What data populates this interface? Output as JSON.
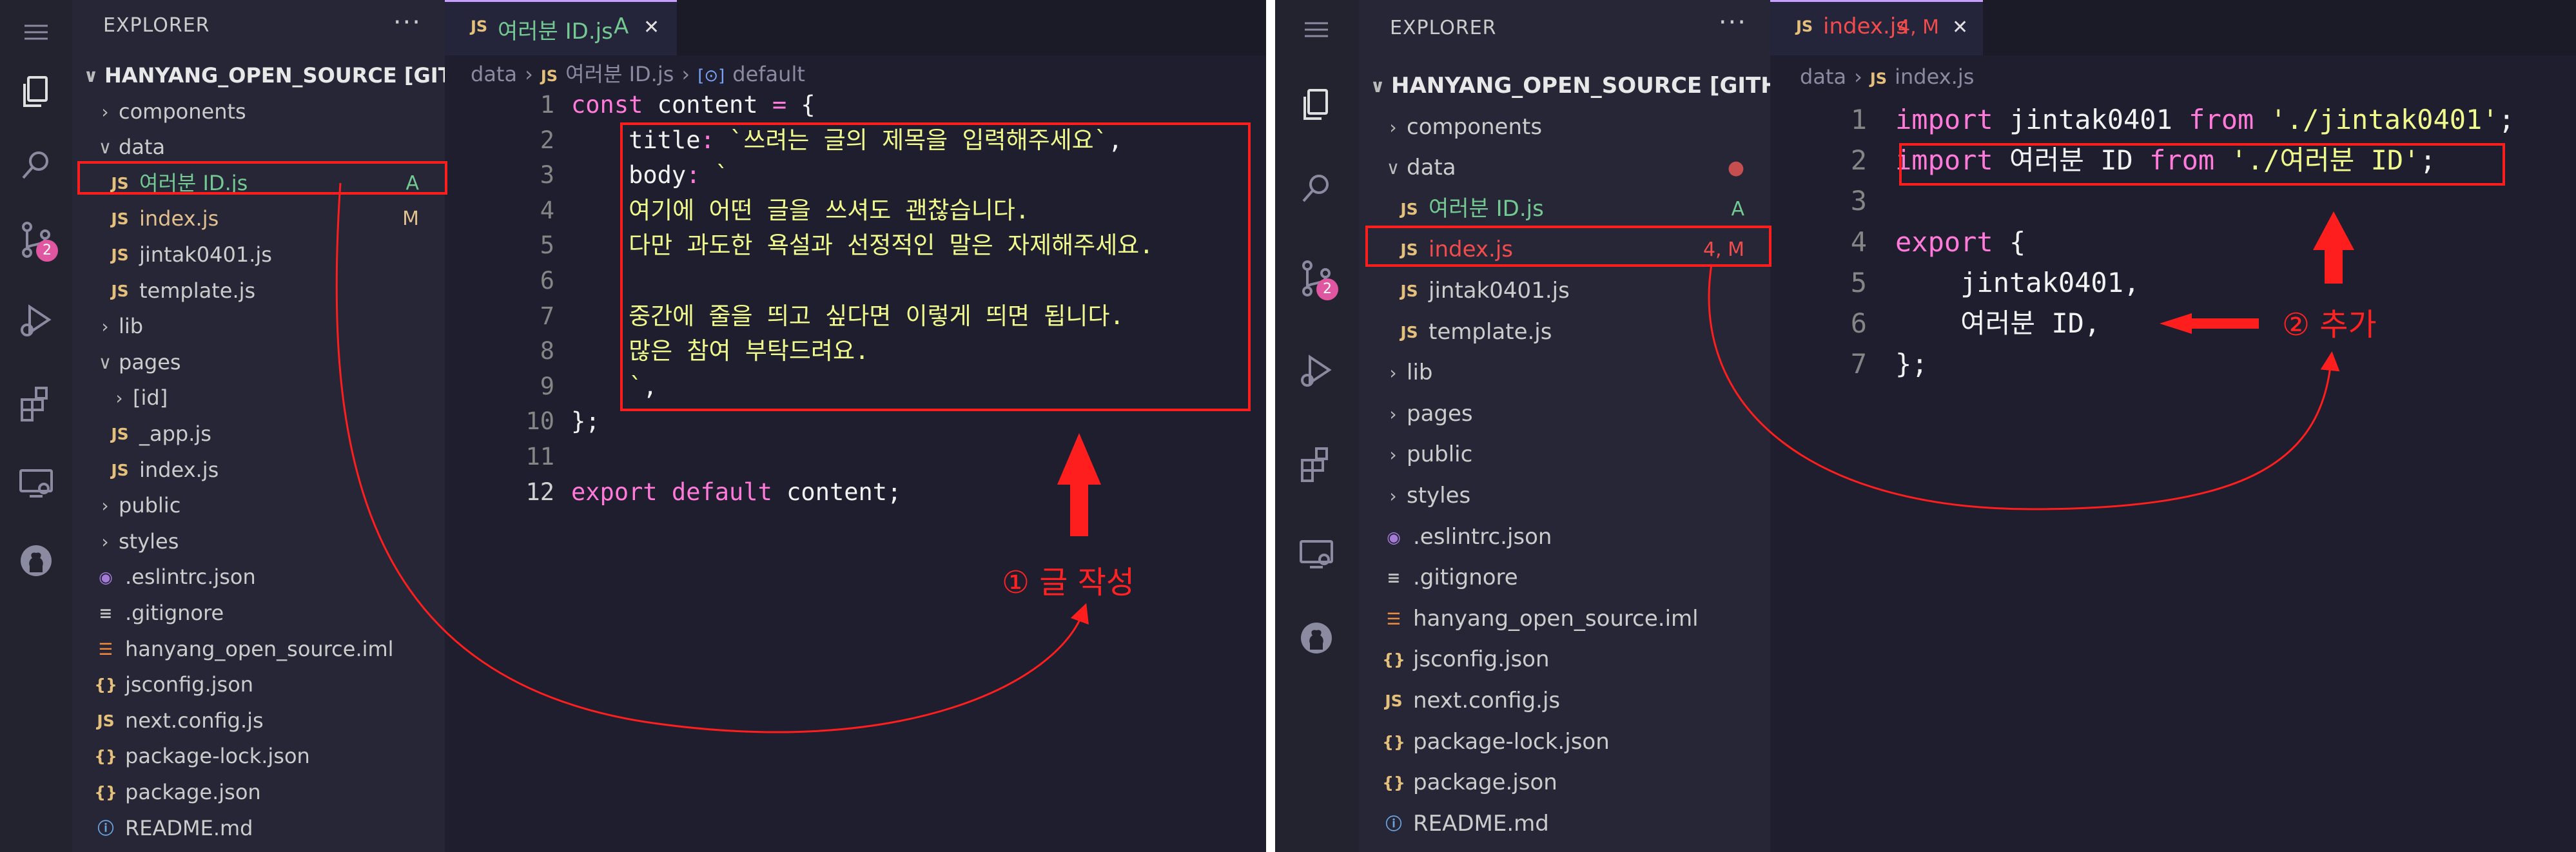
{
  "left": {
    "explorer_title": "EXPLORER",
    "more": "···",
    "scm_badge": "2",
    "tree": [
      {
        "label": "HANYANG_OPEN_SOURCE [GITHUB]",
        "kind": "root",
        "chev": "∨",
        "icon": "",
        "status": ""
      },
      {
        "label": "components",
        "kind": "folder",
        "chev": "›",
        "icon": "",
        "status": ""
      },
      {
        "label": "data",
        "kind": "folder",
        "chev": "∨",
        "icon": "",
        "status": ""
      },
      {
        "label": "여러분 ID.js",
        "kind": "js",
        "chev": "",
        "icon": "JS",
        "status": "A"
      },
      {
        "label": "index.js",
        "kind": "js",
        "chev": "",
        "icon": "JS",
        "status": "M"
      },
      {
        "label": "jintak0401.js",
        "kind": "js",
        "chev": "",
        "icon": "JS",
        "status": ""
      },
      {
        "label": "template.js",
        "kind": "js",
        "chev": "",
        "icon": "JS",
        "status": ""
      },
      {
        "label": "lib",
        "kind": "folder",
        "chev": "›",
        "icon": "",
        "status": ""
      },
      {
        "label": "pages",
        "kind": "folder",
        "chev": "∨",
        "icon": "",
        "status": ""
      },
      {
        "label": "[id]",
        "kind": "folder",
        "chev": "›",
        "icon": "",
        "status": ""
      },
      {
        "label": "_app.js",
        "kind": "js",
        "chev": "",
        "icon": "JS",
        "status": ""
      },
      {
        "label": "index.js",
        "kind": "js",
        "chev": "",
        "icon": "JS",
        "status": ""
      },
      {
        "label": "public",
        "kind": "folder",
        "chev": "›",
        "icon": "",
        "status": ""
      },
      {
        "label": "styles",
        "kind": "folder",
        "chev": "›",
        "icon": "",
        "status": ""
      },
      {
        "label": ".eslintrc.json",
        "kind": "eslint",
        "chev": "",
        "icon": "◉",
        "status": ""
      },
      {
        "label": ".gitignore",
        "kind": "git",
        "chev": "",
        "icon": "≡",
        "status": ""
      },
      {
        "label": "hanyang_open_source.iml",
        "kind": "rss",
        "chev": "",
        "icon": "☰",
        "status": ""
      },
      {
        "label": "jsconfig.json",
        "kind": "json",
        "chev": "",
        "icon": "{}",
        "status": ""
      },
      {
        "label": "next.config.js",
        "kind": "js",
        "chev": "",
        "icon": "JS",
        "status": ""
      },
      {
        "label": "package-lock.json",
        "kind": "json",
        "chev": "",
        "icon": "{}",
        "status": ""
      },
      {
        "label": "package.json",
        "kind": "json",
        "chev": "",
        "icon": "{}",
        "status": ""
      },
      {
        "label": "README.md",
        "kind": "info",
        "chev": "",
        "icon": "ⓘ",
        "status": ""
      }
    ],
    "tab": {
      "icon": "JS",
      "label": "여러분 ID.js",
      "status": "A",
      "close": "✕"
    },
    "breadcrumb": [
      "data",
      "›",
      "JS",
      "여러분 ID.js",
      "›",
      "[⊙]",
      "default"
    ],
    "line_numbers": [
      "1",
      "2",
      "3",
      "4",
      "5",
      "6",
      "7",
      "8",
      "9",
      "10",
      "11",
      "12"
    ],
    "code": [
      [
        {
          "t": "const",
          "c": "kw"
        },
        {
          "t": " content ",
          "c": "var"
        },
        {
          "t": "=",
          "c": "kw"
        },
        {
          "t": " {",
          "c": "var"
        }
      ],
      [
        {
          "t": "    title",
          "c": "prop"
        },
        {
          "t": ":",
          "c": "kw"
        },
        {
          "t": " `쓰려는 글의 제목을 입력해주세요`",
          "c": "str"
        },
        {
          "t": ",",
          "c": "var"
        }
      ],
      [
        {
          "t": "    body",
          "c": "prop"
        },
        {
          "t": ":",
          "c": "kw"
        },
        {
          "t": " `",
          "c": "str"
        }
      ],
      [
        {
          "t": "    여기에 어떤 글을 쓰셔도 괜찮습니다.",
          "c": "str"
        }
      ],
      [
        {
          "t": "    다만 과도한 욕설과 선정적인 말은 자제해주세요.",
          "c": "str"
        }
      ],
      [
        {
          "t": "",
          "c": "str"
        }
      ],
      [
        {
          "t": "    중간에 줄을 띄고 싶다면 이렇게 띄면 됩니다.",
          "c": "str"
        }
      ],
      [
        {
          "t": "    많은 참여 부탁드려요.",
          "c": "str"
        }
      ],
      [
        {
          "t": "    `",
          "c": "str"
        },
        {
          "t": ",",
          "c": "var"
        }
      ],
      [
        {
          "t": "};",
          "c": "var"
        }
      ],
      [
        {
          "t": "",
          "c": "var"
        }
      ],
      [
        {
          "t": "export",
          "c": "kw"
        },
        {
          "t": " default",
          "c": "kw"
        },
        {
          "t": " content;",
          "c": "var"
        }
      ]
    ],
    "annotation": "① 글 작성"
  },
  "right": {
    "explorer_title": "EXPLORER",
    "more": "···",
    "scm_badge": "2",
    "tree": [
      {
        "label": "HANYANG_OPEN_SOURCE [GITHUB]",
        "kind": "root",
        "chev": "∨",
        "icon": "",
        "status": ""
      },
      {
        "label": "components",
        "kind": "folder",
        "chev": "›",
        "icon": "",
        "status": ""
      },
      {
        "label": "data",
        "kind": "folder",
        "chev": "∨",
        "icon": "",
        "status": "●"
      },
      {
        "label": "여러분 ID.js",
        "kind": "js",
        "chev": "",
        "icon": "JS",
        "status": "A"
      },
      {
        "label": "index.js",
        "kind": "js",
        "chev": "",
        "icon": "JS",
        "status": "4, M"
      },
      {
        "label": "jintak0401.js",
        "kind": "js",
        "chev": "",
        "icon": "JS",
        "status": ""
      },
      {
        "label": "template.js",
        "kind": "js",
        "chev": "",
        "icon": "JS",
        "status": ""
      },
      {
        "label": "lib",
        "kind": "folder",
        "chev": "›",
        "icon": "",
        "status": ""
      },
      {
        "label": "pages",
        "kind": "folder",
        "chev": "›",
        "icon": "",
        "status": ""
      },
      {
        "label": "public",
        "kind": "folder",
        "chev": "›",
        "icon": "",
        "status": ""
      },
      {
        "label": "styles",
        "kind": "folder",
        "chev": "›",
        "icon": "",
        "status": ""
      },
      {
        "label": ".eslintrc.json",
        "kind": "eslint",
        "chev": "",
        "icon": "◉",
        "status": ""
      },
      {
        "label": ".gitignore",
        "kind": "git",
        "chev": "",
        "icon": "≡",
        "status": ""
      },
      {
        "label": "hanyang_open_source.iml",
        "kind": "rss",
        "chev": "",
        "icon": "☰",
        "status": ""
      },
      {
        "label": "jsconfig.json",
        "kind": "json",
        "chev": "",
        "icon": "{}",
        "status": ""
      },
      {
        "label": "next.config.js",
        "kind": "js",
        "chev": "",
        "icon": "JS",
        "status": ""
      },
      {
        "label": "package-lock.json",
        "kind": "json",
        "chev": "",
        "icon": "{}",
        "status": ""
      },
      {
        "label": "package.json",
        "kind": "json",
        "chev": "",
        "icon": "{}",
        "status": ""
      },
      {
        "label": "README.md",
        "kind": "info",
        "chev": "",
        "icon": "ⓘ",
        "status": ""
      }
    ],
    "tab": {
      "icon": "JS",
      "label": "index.js",
      "status": "4, M",
      "close": "✕"
    },
    "breadcrumb": [
      "data",
      "›",
      "JS",
      "index.js"
    ],
    "line_numbers": [
      "1",
      "2",
      "3",
      "4",
      "5",
      "6",
      "7"
    ],
    "code": [
      [
        {
          "t": "import",
          "c": "kw"
        },
        {
          "t": " jintak0401 ",
          "c": "var"
        },
        {
          "t": "from",
          "c": "kw"
        },
        {
          "t": " './jintak0401'",
          "c": "str"
        },
        {
          "t": ";",
          "c": "var"
        }
      ],
      [
        {
          "t": "import",
          "c": "kw"
        },
        {
          "t": " 여러분 ID ",
          "c": "var"
        },
        {
          "t": "from",
          "c": "kw"
        },
        {
          "t": " './여러분 ID'",
          "c": "str"
        },
        {
          "t": ";",
          "c": "var"
        }
      ],
      [
        {
          "t": "",
          "c": "var"
        }
      ],
      [
        {
          "t": "export",
          "c": "kw"
        },
        {
          "t": " {",
          "c": "var"
        }
      ],
      [
        {
          "t": "    jintak0401,",
          "c": "var"
        }
      ],
      [
        {
          "t": "    여러분 ID,",
          "c": "var"
        }
      ],
      [
        {
          "t": "};",
          "c": "var"
        }
      ]
    ],
    "annotation": "② 추가"
  },
  "colors": {
    "editor_bg": "#1e1e2e",
    "sidebar_bg": "#262637",
    "keyword": "#ff7ad9",
    "string": "#f1fa8c",
    "js_icon": "#e5c07b",
    "added": "#73c991",
    "modified": "#e2c08d",
    "error": "#f14c4c",
    "annotation": "#ff2222"
  },
  "icons": [
    "menu-icon",
    "files-icon",
    "search-icon",
    "source-control-icon",
    "run-debug-icon",
    "extensions-icon",
    "remote-explorer-icon",
    "github-icon",
    "close-icon",
    "chevron-icon",
    "arrow-icon"
  ]
}
